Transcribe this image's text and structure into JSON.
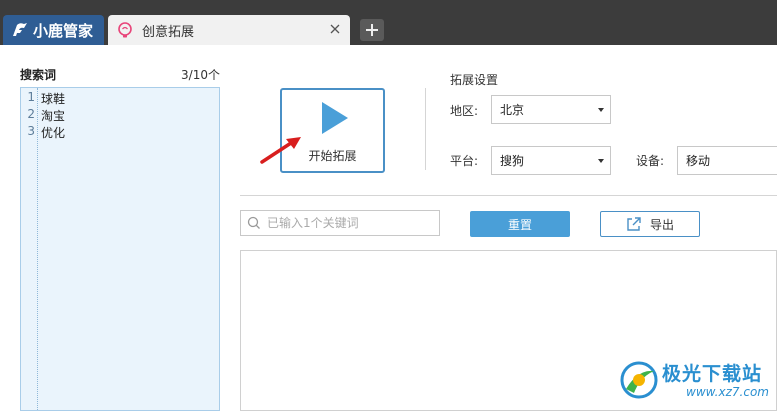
{
  "app": {
    "brand_tab_label": "小鹿管家",
    "doc_tab_label": "创意拓展"
  },
  "keywords": {
    "header_label": "搜索词",
    "count": "3/10个",
    "items": [
      {
        "num": "1",
        "text": "球鞋"
      },
      {
        "num": "2",
        "text": "淘宝"
      },
      {
        "num": "3",
        "text": "优化"
      }
    ]
  },
  "start_button": {
    "label": "开始拓展"
  },
  "settings": {
    "title": "拓展设置",
    "region_label": "地区:",
    "region_value": "北京",
    "platform_label": "平台:",
    "platform_value": "搜狗",
    "device_label": "设备:",
    "device_value": "移动"
  },
  "search": {
    "placeholder": "已输入1个关键词"
  },
  "toolbar": {
    "reset_label": "重置",
    "export_label": "导出"
  },
  "watermark": {
    "name": "极光下载站",
    "url": "www.xz7.com"
  },
  "colors": {
    "titlebar": "#3c3c3c",
    "brand_tab": "#2f5d94",
    "accent": "#4a90c6",
    "reset_button": "#4a9fd8",
    "keyword_panel": "#eaf4fc"
  }
}
